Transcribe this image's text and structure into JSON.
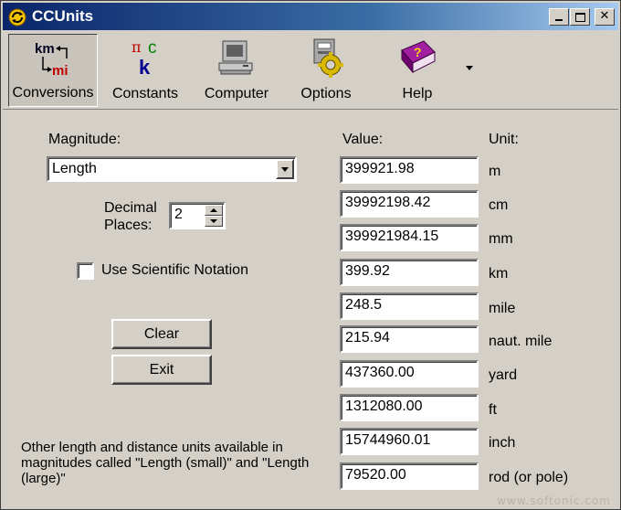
{
  "window": {
    "title": "CCUnits"
  },
  "toolbar": {
    "items": [
      {
        "label": "Conversions"
      },
      {
        "label": "Constants"
      },
      {
        "label": "Computer"
      },
      {
        "label": "Options"
      },
      {
        "label": "Help"
      }
    ],
    "icon_text": {
      "km": "km",
      "mi": "mi",
      "pi": "π",
      "c": "c",
      "k": "k",
      "help": "?"
    }
  },
  "left": {
    "magnitude_label": "Magnitude:",
    "magnitude_value": "Length",
    "decimal_label_1": "Decimal",
    "decimal_label_2": "Places:",
    "decimal_value": "2",
    "scientific_label": "Use Scientific Notation",
    "clear_label": "Clear",
    "exit_label": "Exit",
    "footer_text": "Other length and distance units available in magnitudes called \"Length (small)\" and \"Length (large)\""
  },
  "table": {
    "value_header": "Value:",
    "unit_header": "Unit:",
    "rows": [
      {
        "value": "399921.98",
        "unit": "m"
      },
      {
        "value": "39992198.42",
        "unit": "cm"
      },
      {
        "value": "399921984.15",
        "unit": "mm"
      },
      {
        "value": "399.92",
        "unit": "km"
      },
      {
        "value": "248.5",
        "unit": "mile"
      },
      {
        "value": "215.94",
        "unit": "naut. mile"
      },
      {
        "value": "437360.00",
        "unit": "yard"
      },
      {
        "value": "1312080.00",
        "unit": "ft"
      },
      {
        "value": "15744960.01",
        "unit": "inch"
      },
      {
        "value": "79520.00",
        "unit": "rod (or pole)"
      }
    ]
  },
  "watermark": "www.softonic.com",
  "colors": {
    "titlebar_start": "#0a246a",
    "titlebar_end": "#a6caf0",
    "face": "#d4d0c8"
  }
}
